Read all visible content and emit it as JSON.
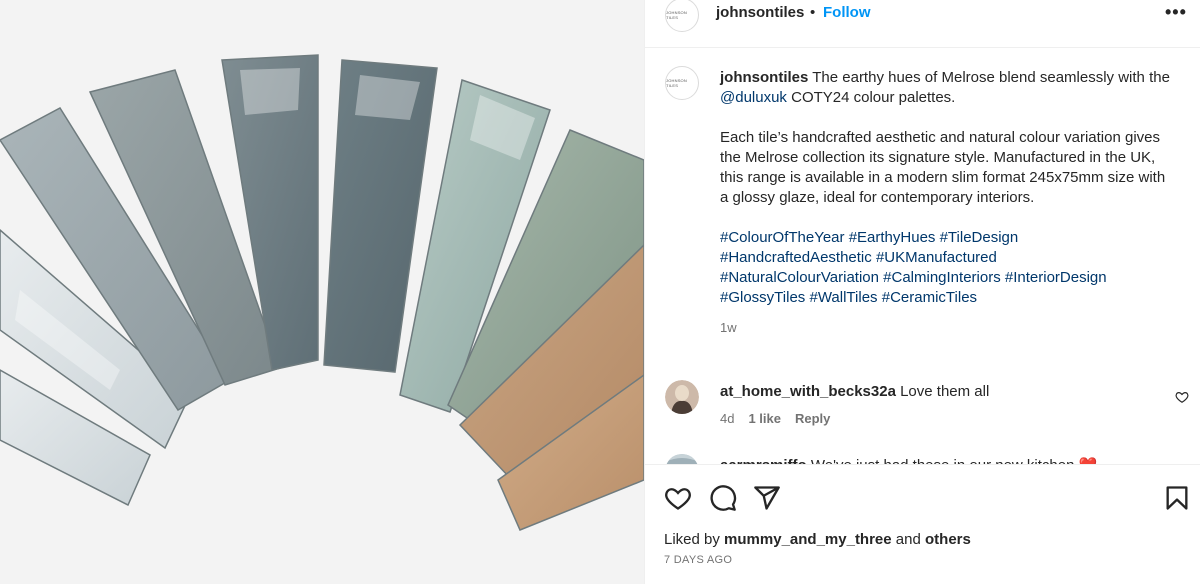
{
  "post": {
    "username": "johnsontiles",
    "separator": "•",
    "follow_label": "Follow",
    "more_label": "•••",
    "avatar_mark": "JOHNSON TILES"
  },
  "caption": {
    "username": "johnsontiles",
    "line1": " The earthy hues of Melrose blend seamlessly with the ",
    "mention": "@duluxuk",
    "line1_end": " COTY24 colour palettes.",
    "paragraph2": "Each tile’s handcrafted aesthetic and natural colour variation gives the Melrose collection its signature style. Manufactured in the UK, this range is available in a modern slim format 245x75mm size with a glossy glaze, ideal for contemporary interiors.",
    "hashtags": [
      "#ColourOfTheYear",
      "#EarthyHues",
      "#TileDesign",
      "#HandcraftedAesthetic",
      "#UKManufactured",
      "#NaturalColourVariation",
      "#CalmingInteriors",
      "#InteriorDesign",
      "#GlossyTiles",
      "#WallTiles",
      "#CeramicTiles"
    ],
    "time": "1w"
  },
  "comments": [
    {
      "username": "at_home_with_becks32a",
      "text": " Love them all",
      "time": "4d",
      "likes": "1 like",
      "reply": "Reply"
    },
    {
      "username": "aarmrsmiffo",
      "text": " We've just had these in our new kitchen ",
      "emoji": "❤️"
    }
  ],
  "footer": {
    "liked_by_prefix": "Liked by ",
    "liked_by_user": "mummy_and_my_three",
    "and": " and ",
    "others": "others",
    "date": "7 DAYS AGO"
  },
  "colors": {
    "accent": "#0095f6",
    "link": "#00376b",
    "muted": "#737373",
    "heart": "#ed4956"
  }
}
